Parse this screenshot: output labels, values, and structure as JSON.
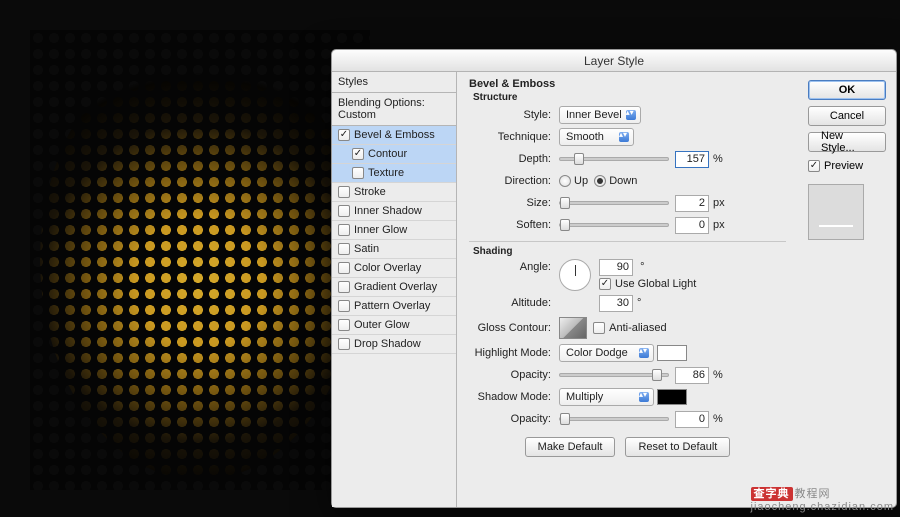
{
  "window": {
    "title": "Layer Style"
  },
  "sidebar": {
    "header": "Styles",
    "blending": "Blending Options: Custom",
    "items": [
      {
        "label": "Bevel & Emboss",
        "checked": true,
        "selected": true,
        "indent": false
      },
      {
        "label": "Contour",
        "checked": true,
        "selected": true,
        "indent": true
      },
      {
        "label": "Texture",
        "checked": false,
        "selected": true,
        "indent": true
      },
      {
        "label": "Stroke",
        "checked": false,
        "selected": false,
        "indent": false
      },
      {
        "label": "Inner Shadow",
        "checked": false,
        "selected": false,
        "indent": false
      },
      {
        "label": "Inner Glow",
        "checked": false,
        "selected": false,
        "indent": false
      },
      {
        "label": "Satin",
        "checked": false,
        "selected": false,
        "indent": false
      },
      {
        "label": "Color Overlay",
        "checked": false,
        "selected": false,
        "indent": false
      },
      {
        "label": "Gradient Overlay",
        "checked": false,
        "selected": false,
        "indent": false
      },
      {
        "label": "Pattern Overlay",
        "checked": false,
        "selected": false,
        "indent": false
      },
      {
        "label": "Outer Glow",
        "checked": false,
        "selected": false,
        "indent": false
      },
      {
        "label": "Drop Shadow",
        "checked": false,
        "selected": false,
        "indent": false
      }
    ]
  },
  "panel": {
    "title": "Bevel & Emboss",
    "structure": {
      "heading": "Structure",
      "style_label": "Style:",
      "style_value": "Inner Bevel",
      "technique_label": "Technique:",
      "technique_value": "Smooth",
      "depth_label": "Depth:",
      "depth_value": "157",
      "depth_unit": "%",
      "direction_label": "Direction:",
      "up_label": "Up",
      "down_label": "Down",
      "direction_value": "Down",
      "size_label": "Size:",
      "size_value": "2",
      "size_unit": "px",
      "soften_label": "Soften:",
      "soften_value": "0",
      "soften_unit": "px"
    },
    "shading": {
      "heading": "Shading",
      "angle_label": "Angle:",
      "angle_value": "90",
      "angle_unit": "°",
      "use_global_label": "Use Global Light",
      "use_global": true,
      "altitude_label": "Altitude:",
      "altitude_value": "30",
      "altitude_unit": "°",
      "gloss_label": "Gloss Contour:",
      "aa_label": "Anti-aliased",
      "aa": false,
      "highlight_mode_label": "Highlight Mode:",
      "highlight_mode_value": "Color Dodge",
      "highlight_opacity_label": "Opacity:",
      "highlight_opacity_value": "86",
      "opacity_unit": "%",
      "shadow_mode_label": "Shadow Mode:",
      "shadow_mode_value": "Multiply",
      "shadow_opacity_label": "Opacity:",
      "shadow_opacity_value": "0"
    },
    "buttons": {
      "make_default": "Make Default",
      "reset": "Reset to Default"
    }
  },
  "right": {
    "ok": "OK",
    "cancel": "Cancel",
    "new_style": "New Style...",
    "preview_label": "Preview",
    "preview_checked": true
  },
  "watermark": {
    "brand": "查字典",
    "text": "教程网",
    "url": "jiaocheng.chazidian.com"
  }
}
